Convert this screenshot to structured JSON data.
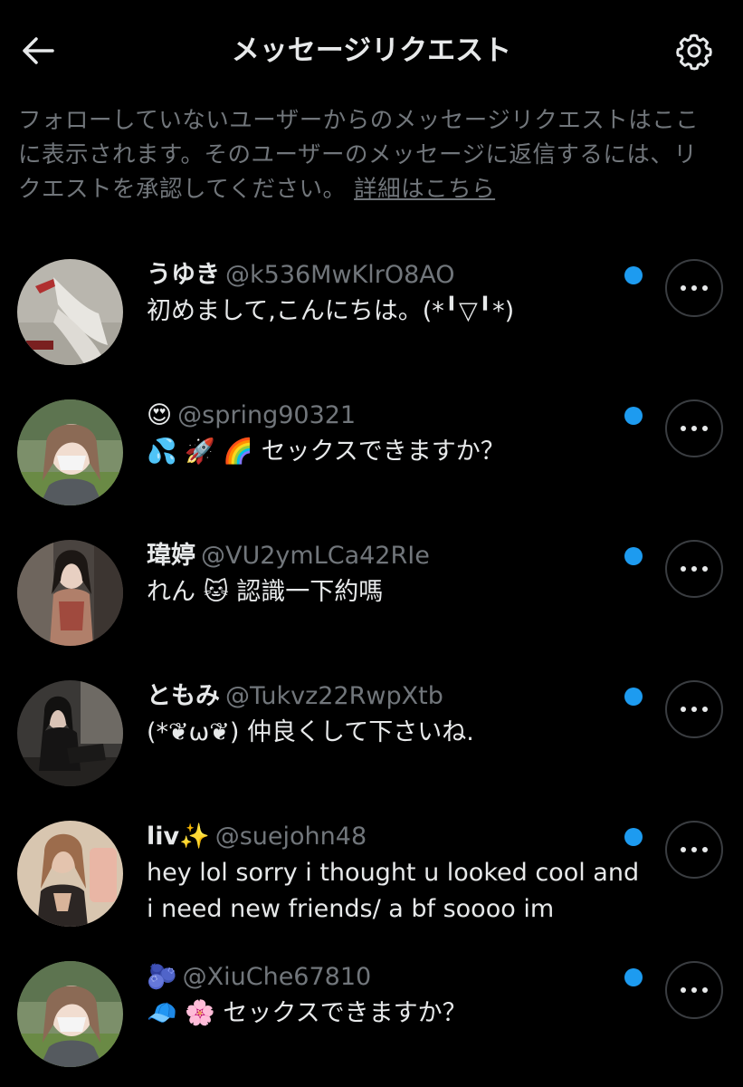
{
  "header": {
    "title": "メッセージリクエスト",
    "back_icon": "arrow-left-icon",
    "settings_icon": "gear-icon"
  },
  "intro": {
    "text": "フォローしていないユーザーからのメッセージリクエストはここに表示されます。そのユーザーのメッセージに返信するには、リクエストを承認してください。",
    "link_label": "詳細はこちら"
  },
  "colors": {
    "background": "#000000",
    "text": "#e7e9ea",
    "muted": "#71767b",
    "unread": "#1d9bf0"
  },
  "requests": [
    {
      "name": "うゆき",
      "handle": "@k536MwKlrO8AO",
      "message": "初めまして,こんにちは。(*╹▽╹*)",
      "unread": true
    },
    {
      "name": "😍",
      "handle": "@spring90321",
      "message": "💦 🚀 🌈 セックスできますか？",
      "unread": true
    },
    {
      "name": "瑋婷",
      "handle": "@VU2ymLCa42RIe",
      "message": "れん 🐱 認識一下約嗎",
      "unread": true
    },
    {
      "name": "ともみ",
      "handle": "@Tukvz22RwpXtb",
      "message": "(*❦ω❦) 仲良くして下さいね.",
      "unread": true
    },
    {
      "name": "liv✨",
      "handle": "@suejohn48",
      "message": "hey lol sorry i thought u looked cool and i need new friends/ a bf soooo im",
      "unread": true
    },
    {
      "name": "🫐",
      "handle": "@XiuChe67810",
      "message": "🧢 🌸 セックスできますか？",
      "unread": true
    }
  ]
}
